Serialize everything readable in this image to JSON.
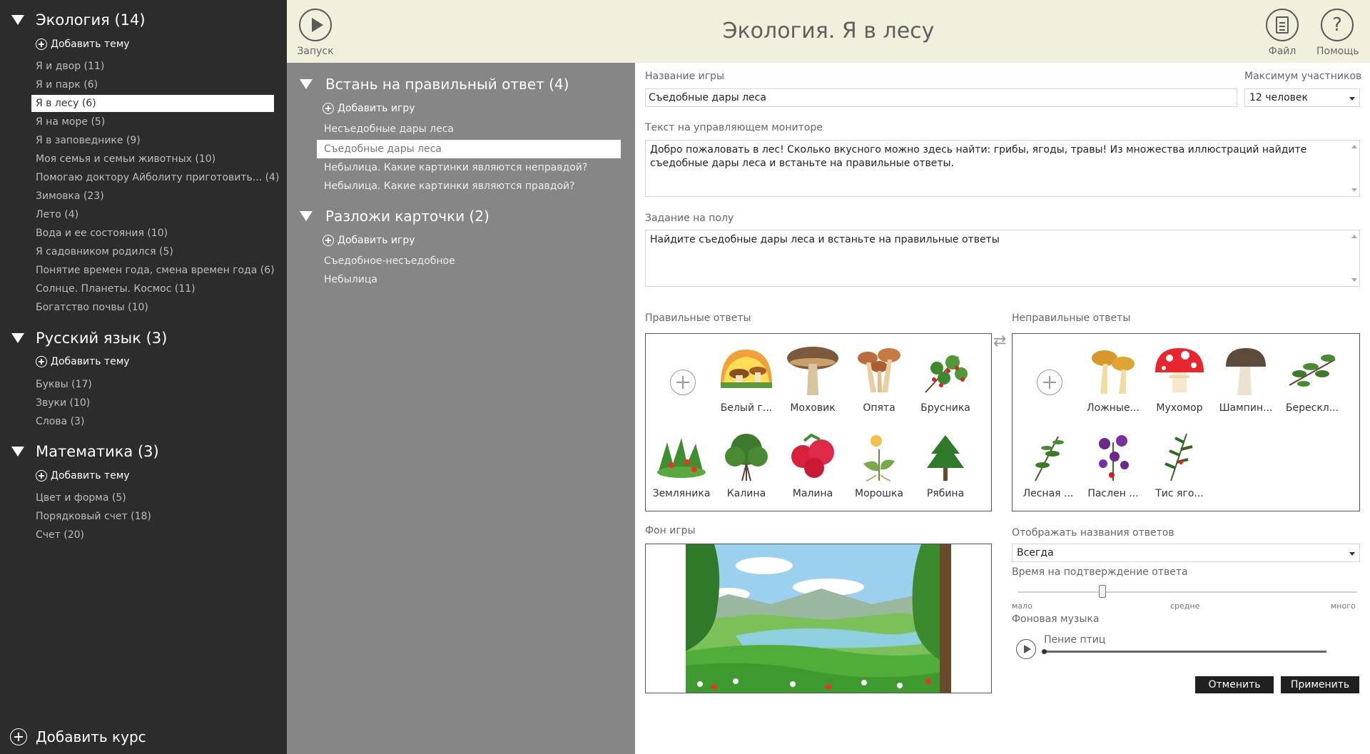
{
  "window_title": "Экология. Я в лесу",
  "topbar": {
    "launch_label": "Запуск",
    "file_label": "Файл",
    "help_label": "Помощь"
  },
  "courses": [
    {
      "title": "Экология (14)",
      "add_topic_label": "Добавить тему",
      "topics": [
        "Я и двор (11)",
        "Я и парк (6)",
        "Я в лесу (6)",
        "Я на море (5)",
        "Я в заповеднике (9)",
        "Моя семья и семьи животных (10)",
        "Помогаю доктору Айболиту приготовить... (4)",
        "Зимовка (23)",
        "Лето (4)",
        "Вода и ее состояния (10)",
        "Я садовником родился (5)",
        "Понятие времен года, смена времен года (6)",
        "Солнце. Планеты. Космос (11)",
        "Богатство почвы (10)"
      ],
      "selected_topic": "Я в лесу (6)"
    },
    {
      "title": "Русский язык (3)",
      "add_topic_label": "Добавить тему",
      "topics": [
        "Буквы (17)",
        "Звуки (10)",
        "Слова (3)"
      ]
    },
    {
      "title": "Математика (3)",
      "add_topic_label": "Добавить тему",
      "topics": [
        "Цвет и форма (5)",
        "Порядковый счет (18)",
        "Счет (20)"
      ]
    }
  ],
  "add_course_label": "Добавить курс",
  "game_groups": [
    {
      "title": "Встань на правильный ответ (4)",
      "add_game_label": "Добавить игру",
      "games": [
        "Несъедобные дары леса",
        "Съедобные дары леса",
        "Небылица. Какие картинки являются неправдой?",
        "Небылица. Какие картинки являются правдой?"
      ],
      "selected_game": "Съедобные дары леса"
    },
    {
      "title": "Разложи карточки (2)",
      "add_game_label": "Добавить игру",
      "games": [
        "Съедобное-несъедобное",
        "Небылица"
      ]
    }
  ],
  "form": {
    "game_name_label": "Название игры",
    "game_name_value": "Съедобные дары леса",
    "max_participants_label": "Максимум участников",
    "max_participants_value": "12 человек",
    "monitor_text_label": "Текст на управляющем мониторе",
    "monitor_text_value": "Добро пожаловать в лес! Сколько вкусного можно здесь найти: грибы, ягоды, травы! Из множества иллюстраций найдите съедобные дары леса и встаньте на правильные ответы.",
    "floor_task_label": "Задание на полу",
    "floor_task_value": "Найдите съедобные дары леса и встаньте на правильные ответы",
    "correct_label": "Правильные ответы",
    "incorrect_label": "Неправильные ответы",
    "correct_answers": [
      "Белый г...",
      "Моховик",
      "Опята",
      "Брусника",
      "Земляника",
      "Калина",
      "Малина",
      "Морошка",
      "Рябина"
    ],
    "incorrect_answers": [
      "Ложные...",
      "Мухомор",
      "Шампин...",
      "Берескл...",
      "Лесная ...",
      "Паслен ...",
      "Тис яго..."
    ],
    "background_label": "Фон игры",
    "show_names_label": "Отображать названия ответов",
    "show_names_value": "Всегда",
    "confirm_time_label": "Время на подтверждение ответа",
    "confirm_time_min": "мало",
    "confirm_time_mid": "средне",
    "confirm_time_max": "много",
    "confirm_time_level": 0.25,
    "music_label": "Фоновая музыка",
    "music_track": "Пение птиц",
    "cancel_label": "Отменить",
    "apply_label": "Применить"
  },
  "colors": {
    "left_bg": "#2c2c2c",
    "mid_bg": "#868686",
    "topbar_bg": "#f2efdc",
    "button_bg": "#202020"
  }
}
